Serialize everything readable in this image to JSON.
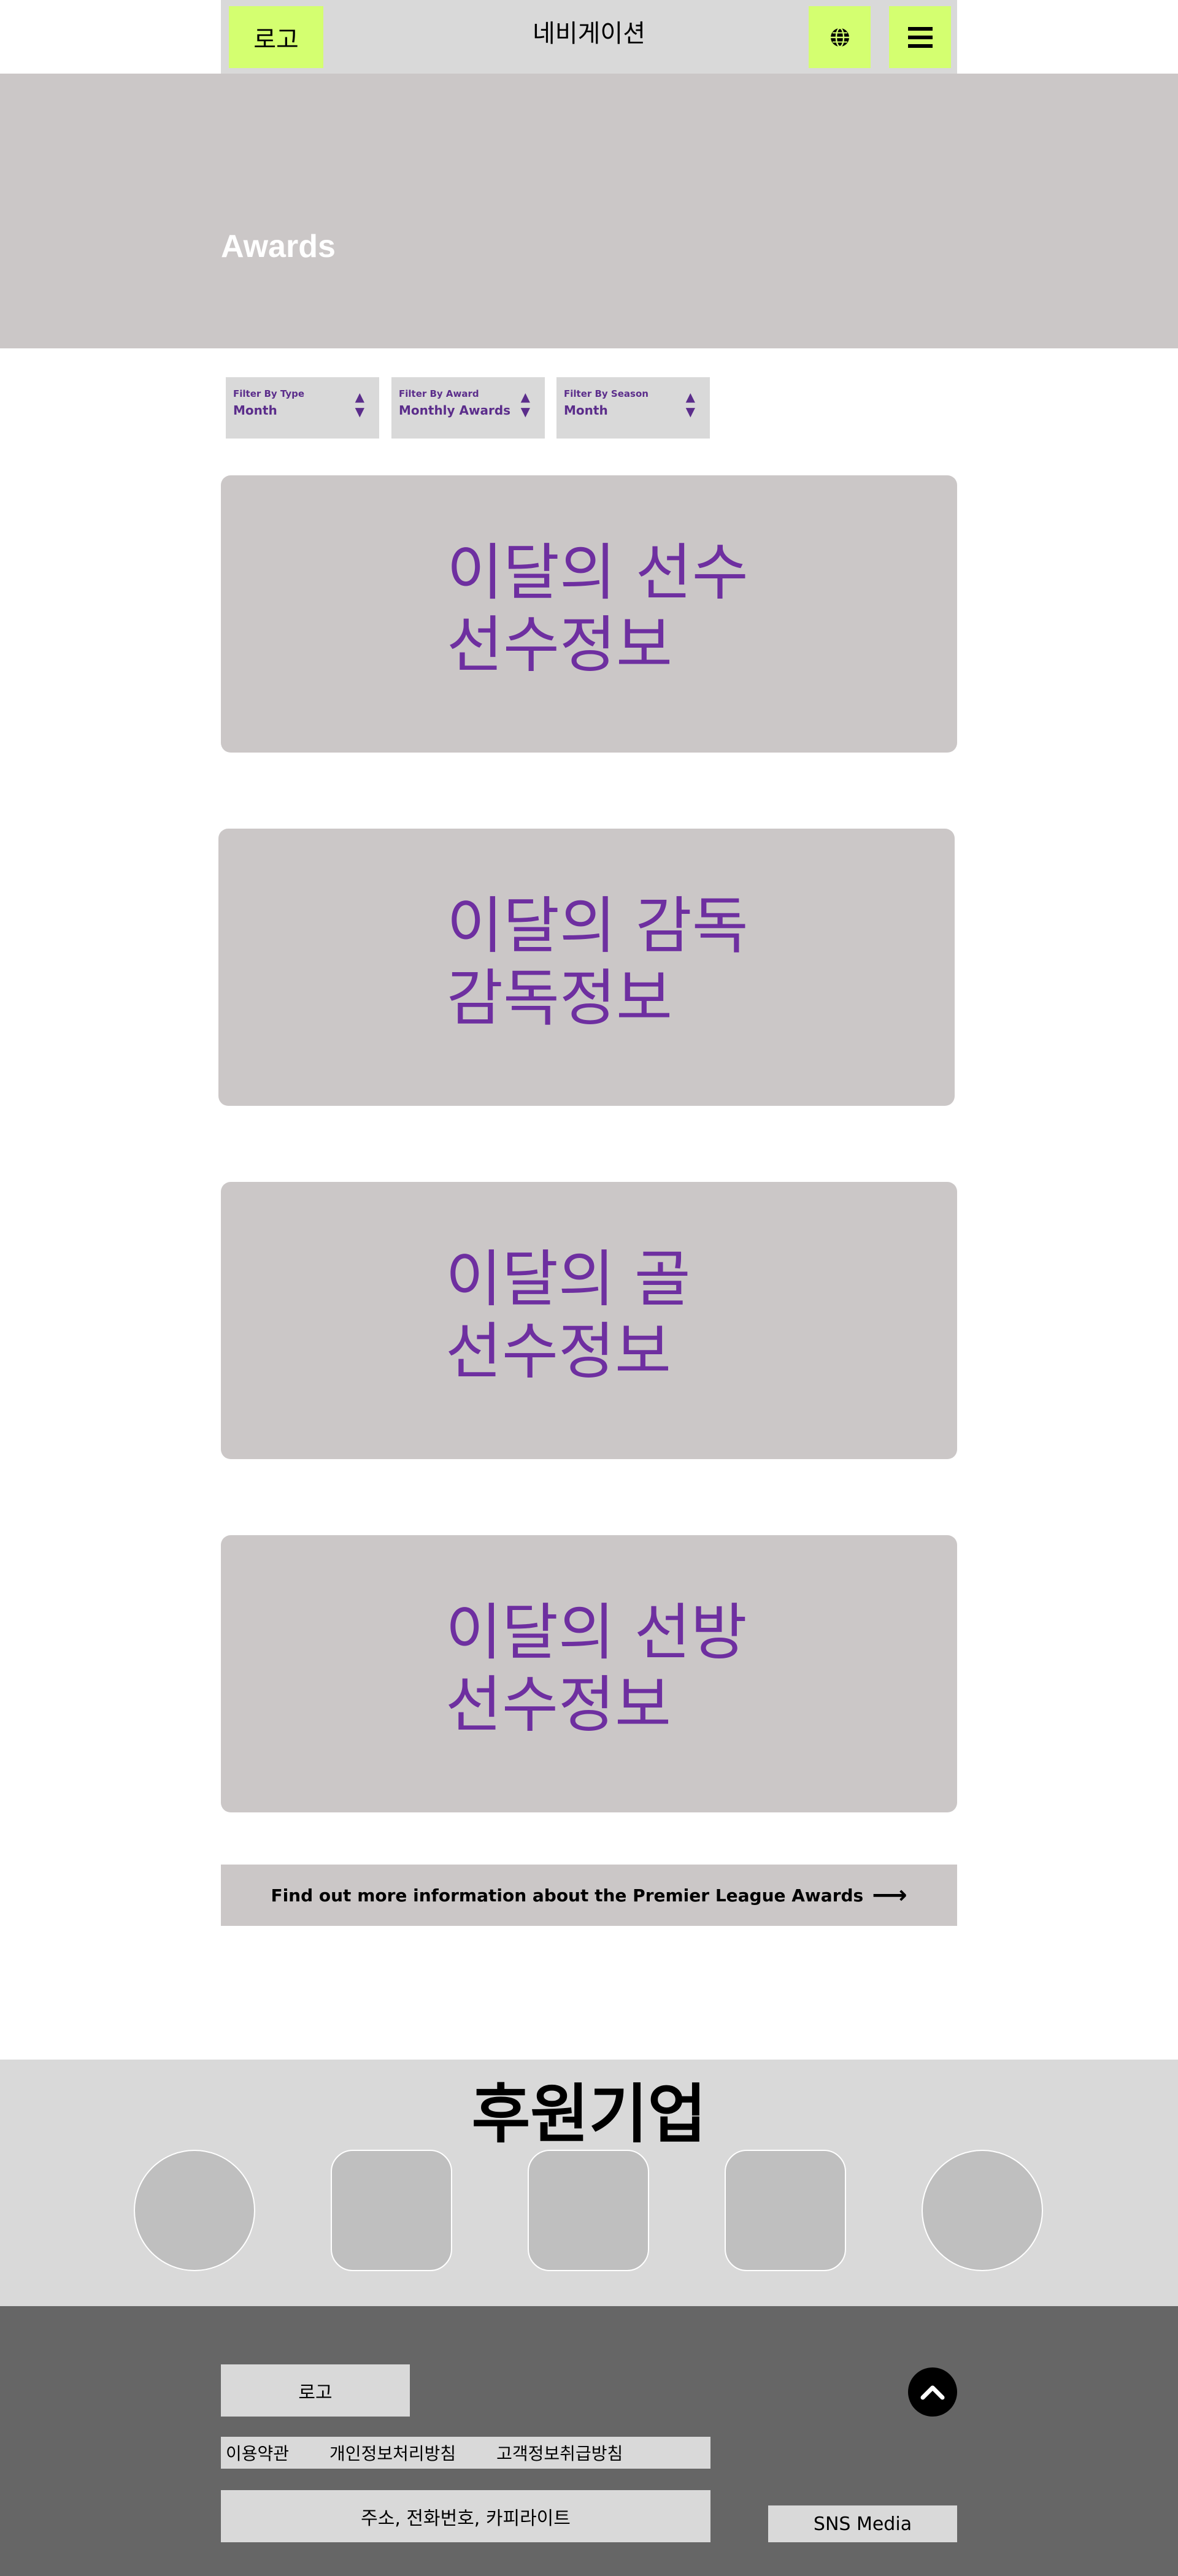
{
  "header": {
    "logo_label": "로고",
    "nav_title": "네비게이션",
    "globe_icon": "globe-icon",
    "menu_icon": "hamburger-menu-icon"
  },
  "hero": {
    "title": "Awards"
  },
  "filters": [
    {
      "label": "Filter By Type",
      "value": "Month"
    },
    {
      "label": "Filter By Award",
      "value": "Monthly Awards"
    },
    {
      "label": "Filter By Season",
      "value": "Month"
    }
  ],
  "cards": [
    {
      "title": "이달의 선수",
      "subtitle": "선수정보"
    },
    {
      "title": "이달의 감독",
      "subtitle": "감독정보"
    },
    {
      "title": "이달의 골",
      "subtitle": "선수정보"
    },
    {
      "title": "이달의 선방",
      "subtitle": "선수정보"
    }
  ],
  "more_info": {
    "label": "Find out more information about the Premier League Awards",
    "icon": "arrow-right-icon"
  },
  "sponsors": {
    "title": "후원기업"
  },
  "footer": {
    "logo_label": "로고",
    "links": [
      "이용약관",
      "개인정보처리방침",
      "고객정보취급방침"
    ],
    "address": "주소, 전화번호, 카피라이트",
    "sns_label": "SNS Media",
    "top_icon": "chevron-up-icon"
  },
  "colors": {
    "accent": "#d4ff70",
    "purple": "#6e2fa0",
    "card_bg": "#cbc7c7",
    "footer_bg": "#666666"
  }
}
